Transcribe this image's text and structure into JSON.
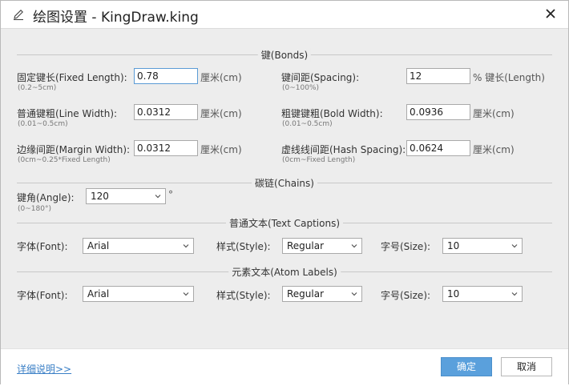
{
  "window": {
    "title": "绘图设置 - KingDraw.king"
  },
  "bonds": {
    "section_label": "键(Bonds)",
    "fixed_length": {
      "label": "固定键长(Fixed Length):",
      "hint": "(0.2~5cm)",
      "value": "0.78",
      "unit": "厘米(cm)"
    },
    "spacing": {
      "label": "键间距(Spacing):",
      "hint": "(0~100%)",
      "value": "12",
      "unit": "% 键长(Length)"
    },
    "line_width": {
      "label": "普通键粗(Line Width):",
      "hint": "(0.01~0.5cm)",
      "value": "0.0312",
      "unit": "厘米(cm)"
    },
    "bold_width": {
      "label": "粗键键粗(Bold Width):",
      "hint": "(0.01~0.5cm)",
      "value": "0.0936",
      "unit": "厘米(cm)"
    },
    "margin_width": {
      "label": "边缘间距(Margin Width):",
      "hint": "(0cm~0.25*Fixed Length)",
      "value": "0.0312",
      "unit": "厘米(cm)"
    },
    "hash_spacing": {
      "label": "虚线线间距(Hash Spacing):",
      "hint": "(0cm~Fixed Length)",
      "value": "0.0624",
      "unit": "厘米(cm)"
    }
  },
  "chains": {
    "section_label": "碳链(Chains)",
    "angle": {
      "label": "键角(Angle):",
      "hint": "(0~180°)",
      "value": "120",
      "unit": "°"
    }
  },
  "text_captions": {
    "section_label": "普通文本(Text Captions)",
    "font": {
      "label": "字体(Font):",
      "value": "Arial"
    },
    "style": {
      "label": "样式(Style):",
      "value": "Regular"
    },
    "size": {
      "label": "字号(Size):",
      "value": "10"
    }
  },
  "atom_labels": {
    "section_label": "元素文本(Atom Labels)",
    "font": {
      "label": "字体(Font):",
      "value": "Arial"
    },
    "style": {
      "label": "样式(Style):",
      "value": "Regular"
    },
    "size": {
      "label": "字号(Size):",
      "value": "10"
    }
  },
  "footer": {
    "details_link": "详细说明>>",
    "ok_label": "确定",
    "cancel_label": "取消"
  },
  "colors": {
    "accent": "#5aa0dc",
    "link": "#3a7fc6",
    "background": "#ededed"
  }
}
